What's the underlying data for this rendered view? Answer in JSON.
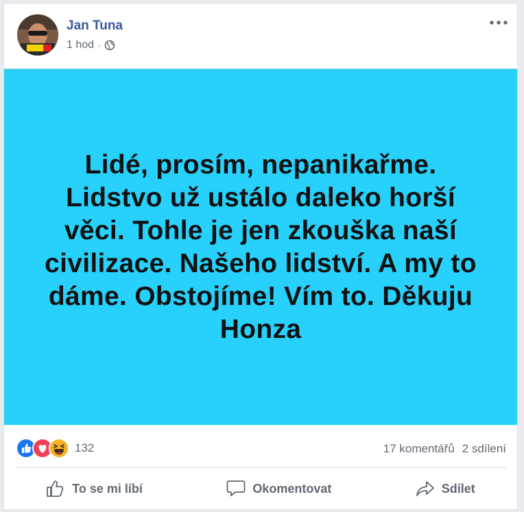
{
  "post": {
    "author": "Jan Tuna",
    "time": "1 hod",
    "separator": "·",
    "privacy_icon": "globe-icon",
    "text": "Lidé, prosím, nepanikařme. Lidstvo už ustálo daleko horší věci. Tohle je jen zkouška naší civilizace. Našeho lidství. A my to dáme. Obstojíme! Vím to. Děkuju Honza",
    "background_color": "#27d1fc"
  },
  "stats": {
    "reactions": [
      "like",
      "love",
      "haha"
    ],
    "reaction_count": "132",
    "comments": "17 komentářů",
    "shares": "2 sdílení"
  },
  "actions": {
    "like": "To se mi líbí",
    "comment": "Okomentovat",
    "share": "Sdílet"
  },
  "colors": {
    "author": "#385898",
    "like": "#1877f2",
    "love": "#f33e58",
    "haha": "#f7b125"
  }
}
